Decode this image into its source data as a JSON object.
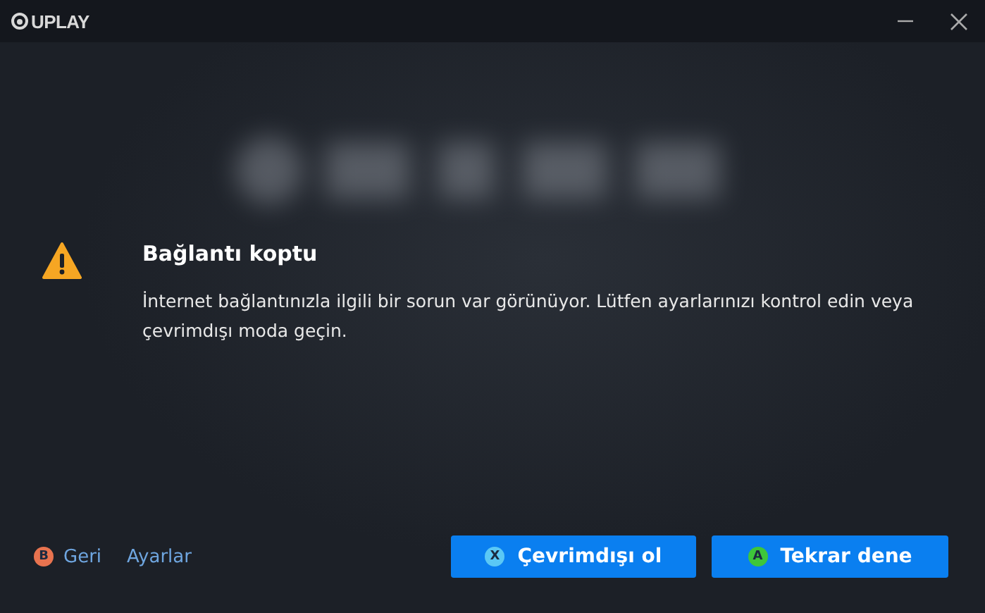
{
  "window": {
    "title": "UPLAY"
  },
  "dialog": {
    "title": "Bağlantı koptu",
    "message": "İnternet bağlantınızla ilgili bir sorun var görünüyor. Lütfen ayarlarınızı kontrol edin veya çevrimdışı moda geçin."
  },
  "links": [
    {
      "label": "Geri",
      "badge": "B",
      "color": "#e8734f"
    },
    {
      "label": "Ayarlar"
    }
  ],
  "buttons": [
    {
      "label": "Çevrimdışı ol",
      "badge": "X",
      "color": "#5bc8f5"
    },
    {
      "label": "Tekrar dene",
      "badge": "A",
      "color": "#3ec63a"
    }
  ]
}
